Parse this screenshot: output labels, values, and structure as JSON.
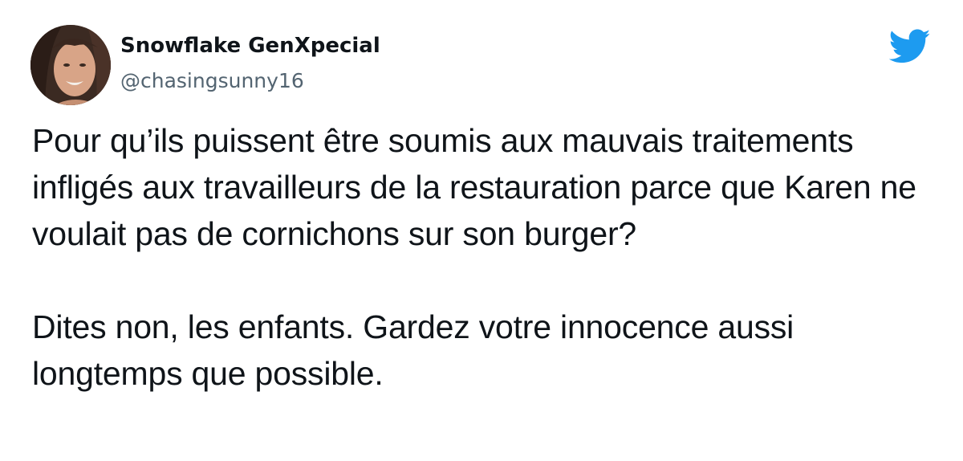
{
  "author": {
    "display_name": "Snowflake GenXpecial",
    "handle": "@chasingsunny16",
    "avatar_icon": "profile-photo"
  },
  "brand": {
    "icon": "twitter-bird-icon",
    "color": "#1d9bf0"
  },
  "tweet": {
    "paragraphs": [
      "Pour qu’ils puissent être soumis aux mauvais traitements infligés aux travailleurs de la restauration parce que Karen ne voulait pas de cornichons sur son burger?",
      "Dites non, les enfants. Gardez votre innocence aussi longtemps que possible."
    ]
  }
}
